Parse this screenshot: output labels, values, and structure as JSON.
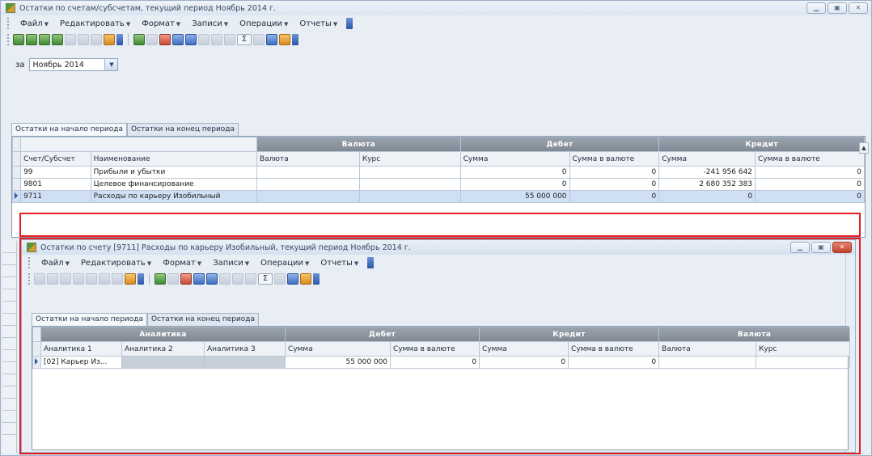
{
  "main": {
    "title": "Остатки по счетам/субсчетам, текущий период Ноябрь 2014 г.",
    "menu": [
      "Файл",
      "Редактировать",
      "Формат",
      "Записи",
      "Операции",
      "Отчеты"
    ],
    "period_label": "за",
    "period_value": "Ноябрь 2014",
    "tabs": [
      "Остатки на начало периода",
      "Остатки на конец периода"
    ],
    "groups": {
      "currency": "Валюта",
      "debit": "Дебет",
      "credit": "Кредит"
    },
    "columns": [
      "Счет/Субсчет",
      "Наименование",
      "Валюта",
      "Курс",
      "Сумма",
      "Сумма в валюте",
      "Сумма",
      "Сумма в валюте"
    ],
    "rows": [
      {
        "account": "99",
        "name": "Прибыли и убытки",
        "currency": "",
        "rate": "",
        "debit_sum": "",
        "debit_cur": "0",
        "credit_sum": "0",
        "credit_cur": "-241 956 642",
        "last": "0"
      },
      {
        "account": "9801",
        "name": "Целевое финансирование",
        "currency": "",
        "rate": "",
        "debit_sum": "",
        "debit_cur": "0",
        "credit_sum": "0",
        "credit_cur": "2 680 352 383",
        "last": "0"
      },
      {
        "account": "9711",
        "name": "Расходы по карьеру Изобильный",
        "currency": "",
        "rate": "",
        "debit_sum": "",
        "debit_cur": "55 000 000",
        "credit_sum": "0",
        "credit_cur": "0",
        "last": "0"
      }
    ]
  },
  "sub": {
    "title": "Остатки по счету [9711] Расходы по карьеру Изобильный, текущий период Ноябрь 2014 г.",
    "menu": [
      "Файл",
      "Редактировать",
      "Формат",
      "Записи",
      "Операции",
      "Отчеты"
    ],
    "tabs": [
      "Остатки на начало периода",
      "Остатки на конец периода"
    ],
    "groups": {
      "analytics": "Аналитика",
      "debit": "Дебет",
      "credit": "Кредит",
      "currency": "Валюта"
    },
    "columns": [
      "Аналитика 1",
      "Аналитика 2",
      "Аналитика 3",
      "Сумма",
      "Сумма в валюте",
      "Сумма",
      "Сумма в валюте",
      "Валюта",
      "Курс"
    ],
    "row": {
      "a1": "[02] Карьер Из...",
      "a2": "",
      "a3": "",
      "debit_sum": "55 000 000",
      "debit_cur": "0",
      "credit_sum": "0",
      "credit_cur": "0",
      "currency": "",
      "rate": ""
    }
  },
  "colors": {
    "highlight": "#e11d22",
    "selection": "#cfe0f5"
  }
}
